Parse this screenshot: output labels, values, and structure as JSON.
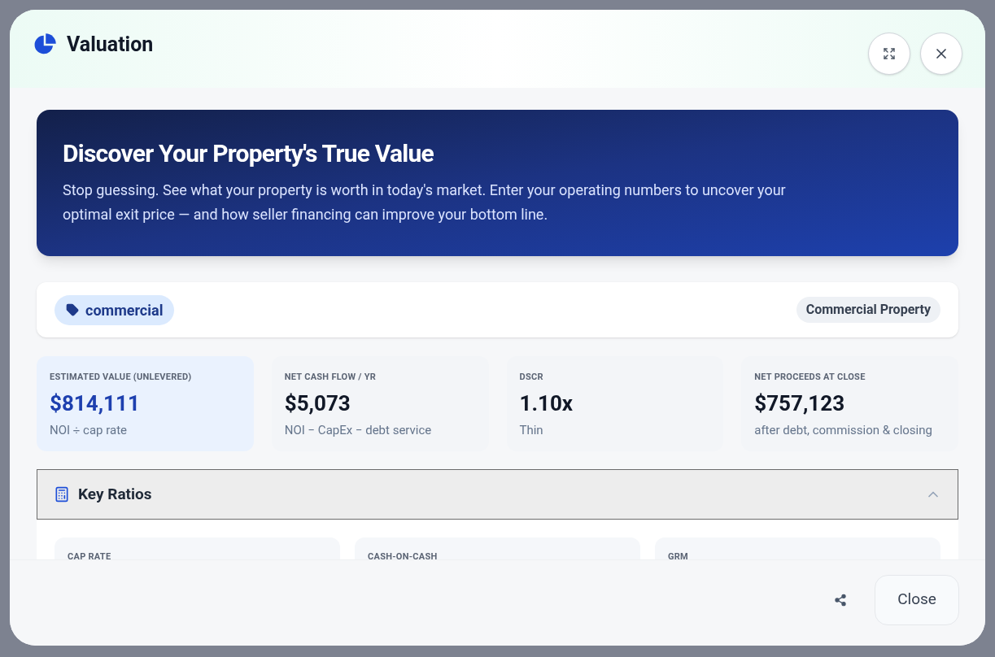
{
  "dialog": {
    "title": "Valuation"
  },
  "hero": {
    "title": "Discover Your Property's True Value",
    "text": "Stop guessing. See what your property is worth in today's market. Enter your operating numbers to uncover your optimal exit price — and how seller financing can improve your bottom line."
  },
  "tags": {
    "tag": "commercial",
    "type": "Commercial Property"
  },
  "stats": [
    {
      "label": "ESTIMATED VALUE (UNLEVERED)",
      "value": "$814,111",
      "note": "NOI ÷ cap rate",
      "highlighted": true
    },
    {
      "label": "NET CASH FLOW / YR",
      "value": "$5,073",
      "note": "NOI − CapEx − debt service",
      "highlighted": false
    },
    {
      "label": "DSCR",
      "value": "1.10x",
      "note": "Thin",
      "highlighted": false
    },
    {
      "label": "NET PROCEEDS AT CLOSE",
      "value": "$757,123",
      "note": "after debt, commission & closing",
      "highlighted": false
    }
  ],
  "key_ratios": {
    "title": "Key Ratios",
    "expanded": true,
    "cards": [
      {
        "label": "CAP RATE"
      },
      {
        "label": "CASH-ON-CASH"
      },
      {
        "label": "GRM"
      }
    ]
  },
  "footer": {
    "close": "Close"
  }
}
